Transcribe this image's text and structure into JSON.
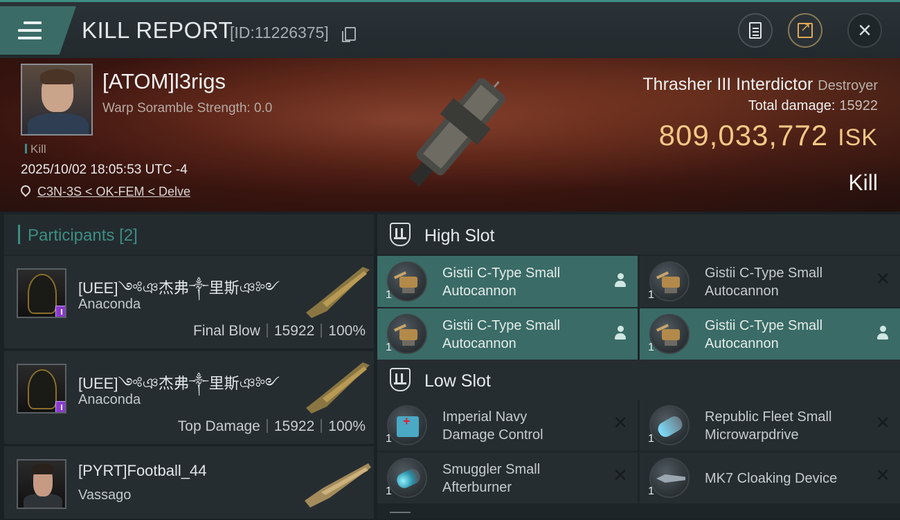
{
  "header": {
    "title": "KILL REPORT",
    "report_id": "[ID:11226375]"
  },
  "victim": {
    "pilot": "[ATOM]l3rigs",
    "warp_scramble": "Warp Soramble Strength: 0.0",
    "tag": "Kill",
    "datetime": "2025/10/02 18:05:53 UTC -4",
    "location": "C3N-3S < OK-FEM < Delve",
    "ship": "Thrasher III Interdictor",
    "ship_category": "Destroyer",
    "total_damage_label": "Total damage:",
    "total_damage": "15922",
    "isk_value": "809,033,772",
    "isk_unit": "ISK",
    "result": "Kill"
  },
  "participants": {
    "label": "Participants",
    "count": "[2]",
    "rows": [
      {
        "name": "[UEE]༺ঞ杰弗༒里斯ঞ༻",
        "ship": "Anaconda",
        "role": "Final Blow",
        "damage": "15922",
        "percent": "100%"
      },
      {
        "name": "[UEE]༺ঞ杰弗༒里斯ঞ༻",
        "ship": "Anaconda",
        "role": "Top Damage",
        "damage": "15922",
        "percent": "100%"
      },
      {
        "name": "[PYRT]Football_44",
        "ship": "Vassago"
      }
    ]
  },
  "high_slot": {
    "label": "High Slot",
    "modules": [
      {
        "name_line1": "Gistii C-Type Small",
        "name_line2": "Autocannon",
        "qty": "1"
      },
      {
        "name_line1": "Gistii C-Type Small",
        "name_line2": "Autocannon",
        "qty": "1"
      },
      {
        "name_line1": "Gistii C-Type Small",
        "name_line2": "Autocannon",
        "qty": "1"
      },
      {
        "name_line1": "Gistii C-Type Small",
        "name_line2": "Autocannon",
        "qty": "1"
      }
    ]
  },
  "low_slot": {
    "label": "Low Slot",
    "modules": [
      {
        "name_line1": "Imperial Navy",
        "name_line2": "Damage Control",
        "qty": "1"
      },
      {
        "name_line1": "Republic Fleet Small",
        "name_line2": "Microwarpdrive",
        "qty": "1"
      },
      {
        "name_line1": "Smuggler Small",
        "name_line2": "Afterburner",
        "qty": "1"
      },
      {
        "name_line1": "MK7 Cloaking Device",
        "name_line2": "",
        "qty": "1"
      }
    ]
  },
  "colors": {
    "accent": "#3e8d84",
    "isk": "#f3c886",
    "active_module": "#3a6b66"
  }
}
